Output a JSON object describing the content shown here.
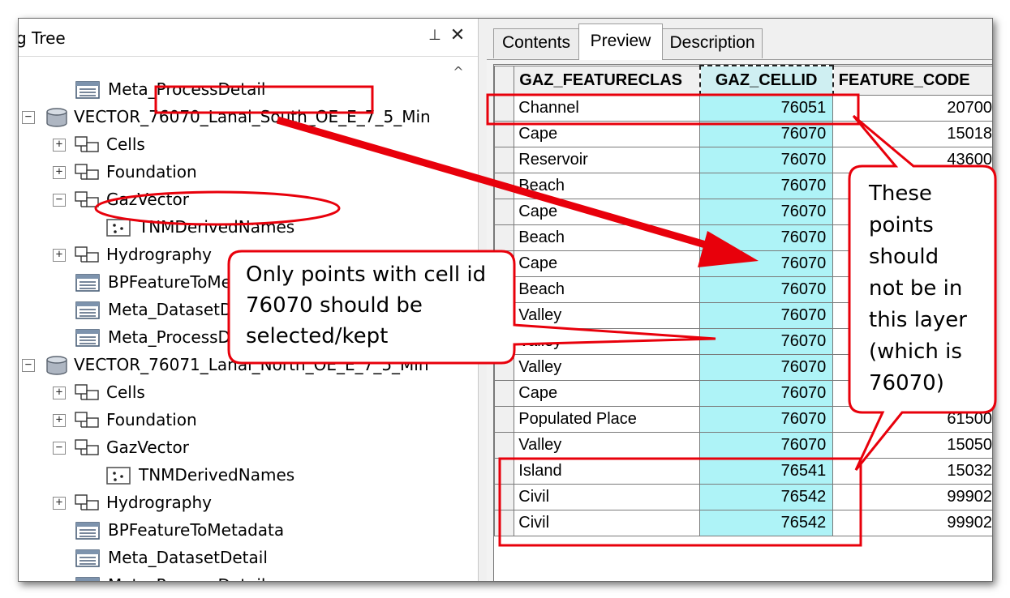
{
  "catalog": {
    "title_fragment": "g Tree",
    "rows": [
      {
        "label": "Meta_ProcessDetail"
      },
      {
        "label": "VECTOR_76070_Lanai_South_OE_E_7_5_Min"
      },
      {
        "label": "Cells"
      },
      {
        "label": "Foundation"
      },
      {
        "label": "GazVector"
      },
      {
        "label": "TNMDerivedNames"
      },
      {
        "label": "Hydrography"
      },
      {
        "label": "BPFeatureToMetadata"
      },
      {
        "label": "Meta_DatasetDetail"
      },
      {
        "label": "Meta_ProcessDetail"
      },
      {
        "label": "VECTOR_76071_Lanai_North_OE_E_7_5_Min"
      },
      {
        "label": "Cells"
      },
      {
        "label": "Foundation"
      },
      {
        "label": "GazVector"
      },
      {
        "label": "TNMDerivedNames"
      },
      {
        "label": "Hydrography"
      },
      {
        "label": "BPFeatureToMetadata"
      },
      {
        "label": "Meta_DatasetDetail"
      },
      {
        "label": "Meta_ProcessDetail"
      }
    ]
  },
  "tabs": [
    "Contents",
    "Preview",
    "Description"
  ],
  "active_tab": "Preview",
  "table": {
    "columns": [
      "GAZ_FEATURECLAS",
      "GAZ_CELLID",
      "FEATURE_CODE"
    ],
    "rows": [
      {
        "cls": "Channel",
        "cellid": "76051",
        "code": "20700"
      },
      {
        "cls": "Cape",
        "cellid": "76070",
        "code": "15018"
      },
      {
        "cls": "Reservoir",
        "cellid": "76070",
        "code": "43600"
      },
      {
        "cls": "Beach",
        "cellid": "76070",
        "code": ""
      },
      {
        "cls": "Cape",
        "cellid": "76070",
        "code": ""
      },
      {
        "cls": "Beach",
        "cellid": "76070",
        "code": ""
      },
      {
        "cls": "Cape",
        "cellid": "76070",
        "code": ""
      },
      {
        "cls": "Beach",
        "cellid": "76070",
        "code": ""
      },
      {
        "cls": "Valley",
        "cellid": "76070",
        "code": ""
      },
      {
        "cls": "Valley",
        "cellid": "76070",
        "code": ""
      },
      {
        "cls": "Valley",
        "cellid": "76070",
        "code": ""
      },
      {
        "cls": "Cape",
        "cellid": "76070",
        "code": ""
      },
      {
        "cls": "Populated Place",
        "cellid": "76070",
        "code": "61500"
      },
      {
        "cls": "Valley",
        "cellid": "76070",
        "code": "15050"
      },
      {
        "cls": "Island",
        "cellid": "76541",
        "code": "15032"
      },
      {
        "cls": "Civil",
        "cellid": "76542",
        "code": "99902"
      },
      {
        "cls": "Civil",
        "cellid": "76542",
        "code": "99902"
      }
    ]
  },
  "annotations": {
    "callout_left": [
      "Only points with cell id",
      "76070 should be",
      "selected/kept"
    ],
    "callout_right": [
      "These",
      "points",
      "should",
      "not be in",
      "this layer",
      "(which is",
      "76070)"
    ],
    "color": "#e8000b"
  },
  "colors": {
    "selected_column_fill": "#aef3f7",
    "header_fill": "#f0f0f0",
    "annotation_red": "#e8000b"
  }
}
